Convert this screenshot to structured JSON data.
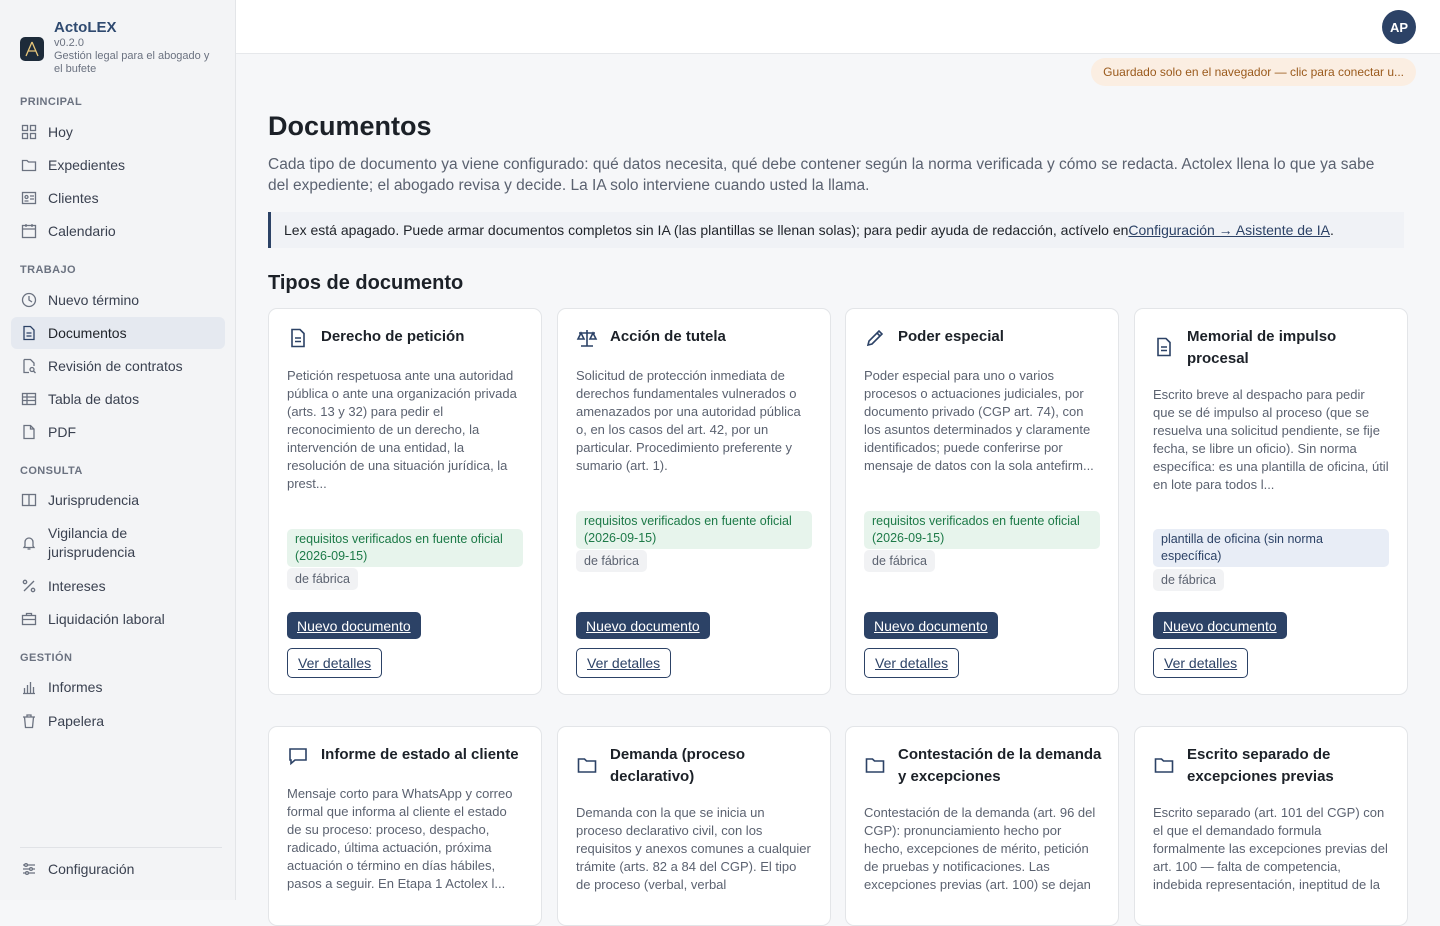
{
  "brand": {
    "name": "ActoLEX",
    "version": "v0.2.0",
    "tagline": "Gestión legal para el abogado y el bufete"
  },
  "sidebar": {
    "sections": {
      "principal": "PRINCIPAL",
      "trabajo": "TRABAJO",
      "consulta": "CONSULTA",
      "gestion": "GESTIÓN"
    },
    "items": {
      "hoy": "Hoy",
      "expedientes": "Expedientes",
      "clientes": "Clientes",
      "calendario": "Calendario",
      "nuevo_termino": "Nuevo término",
      "documentos": "Documentos",
      "revision": "Revisión de contratos",
      "tabla": "Tabla de datos",
      "pdf": "PDF",
      "jurisprudencia": "Jurisprudencia",
      "vigilancia": "Vigilancia de jurisprudencia",
      "intereses": "Intereses",
      "liquidacion": "Liquidación laboral",
      "informes": "Informes",
      "papelera": "Papelera",
      "configuracion": "Configuración"
    }
  },
  "topbar": {
    "avatar": "AP",
    "save_status": "Guardado solo en el navegador — clic para conectar u..."
  },
  "main": {
    "title": "Documentos",
    "intro": "Cada tipo de documento ya viene configurado: qué datos necesita, qué debe contener según la norma verificada y cómo se redacta. Actolex llena lo que ya sabe del expediente; el abogado revisa y decide. La IA solo interviene cuando usted la llama.",
    "notice_text": "Lex está apagado. Puede armar documentos completos sin IA (las plantillas se llenan solas); para pedir ayuda de redacción, actívelo en ",
    "notice_link": "Configuración → Asistente de IA",
    "notice_end": ".",
    "section_title": "Tipos de documento"
  },
  "cards": [
    {
      "title": "Derecho de petición",
      "desc": "Petición respetuosa ante una autoridad pública o ante una organización privada (arts. 13 y 32) para pedir el reconocimiento de un derecho, la intervención de una entidad, la resolución de una situación jurídica, la prest...",
      "badge": "requisitos verificados en fuente oficial (2026-09-15)",
      "tag": "de fábrica",
      "primary": "Nuevo documento",
      "secondary": "Ver detalles",
      "icon": "document-icon"
    },
    {
      "title": "Acción de tutela",
      "desc": "Solicitud de protección inmediata de derechos fundamentales vulnerados o amenazados por una autoridad pública o, en los casos del art. 42, por un particular. Procedimiento preferente y sumario (art. 1).",
      "badge": "requisitos verificados en fuente oficial (2026-09-15)",
      "tag": "de fábrica",
      "primary": "Nuevo documento",
      "secondary": "Ver detalles",
      "icon": "scale-icon"
    },
    {
      "title": "Poder especial",
      "desc": "Poder especial para uno o varios procesos o actuaciones judiciales, por documento privado (CGP art. 74), con los asuntos determinados y claramente identificados; puede conferirse por mensaje de datos con la sola antefirm...",
      "badge": "requisitos verificados en fuente oficial (2026-09-15)",
      "tag": "de fábrica",
      "primary": "Nuevo documento",
      "secondary": "Ver detalles",
      "icon": "pen-icon"
    },
    {
      "title": "Memorial de impulso procesal",
      "desc": "Escrito breve al despacho para pedir que se dé impulso al proceso (que se resuelva una solicitud pendiente, se fije fecha, se libre un oficio). Sin norma específica: es una plantilla de oficina, útil en lote para todos l...",
      "badge": "plantilla de oficina (sin norma específica)",
      "tag": "de fábrica",
      "primary": "Nuevo documento",
      "secondary": "Ver detalles",
      "icon": "document-icon"
    },
    {
      "title": "Informe de estado al cliente",
      "desc": "Mensaje corto para WhatsApp y correo formal que informa al cliente el estado de su proceso: proceso, despacho, radicado, última actuación, próxima actuación o término en días hábiles, pasos a seguir. En Etapa 1 Actolex l...",
      "icon": "chat-icon"
    },
    {
      "title": "Demanda (proceso declarativo)",
      "desc": "Demanda con la que se inicia un proceso declarativo civil, con los requisitos y anexos comunes a cualquier trámite (arts. 82 a 84 del CGP). El tipo de proceso (verbal, verbal",
      "icon": "folder-icon"
    },
    {
      "title": "Contestación de la demanda y excepciones",
      "desc": "Contestación de la demanda (art. 96 del CGP): pronunciamiento hecho por hecho, excepciones de mérito, petición de pruebas y notificaciones. Las excepciones previas (art. 100) se dejan",
      "icon": "folder-icon"
    },
    {
      "title": "Escrito separado de excepciones previas",
      "desc": "Escrito separado (art. 101 del CGP) con el que el demandado formula formalmente las excepciones previas del art. 100 — falta de competencia, indebida representación, ineptitud de la",
      "icon": "folder-icon"
    }
  ]
}
